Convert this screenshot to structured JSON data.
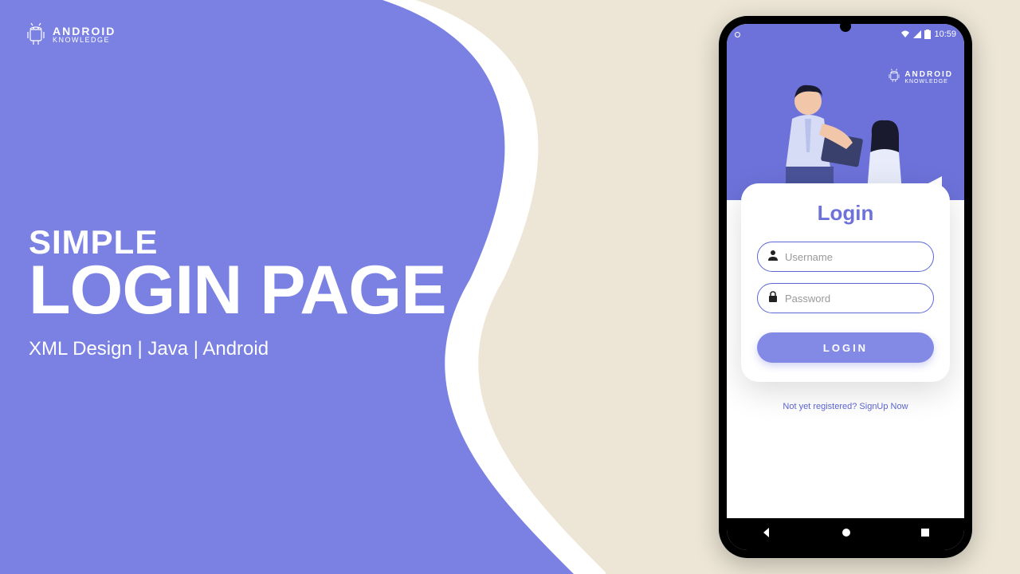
{
  "brand": {
    "line1": "ANDROID",
    "line2": "KNOWLEDGE"
  },
  "hero": {
    "simple": "SIMPLE",
    "title": "LOGIN PAGE",
    "sub": "XML Design | Java | Android"
  },
  "statusbar": {
    "time": "10:59"
  },
  "login": {
    "title": "Login",
    "username_placeholder": "Username",
    "password_placeholder": "Password",
    "button": "LOGIN"
  },
  "signup": {
    "text": "Not yet registered? SignUp Now"
  },
  "colors": {
    "accent": "#6c72d9",
    "background": "#ede6d6"
  }
}
